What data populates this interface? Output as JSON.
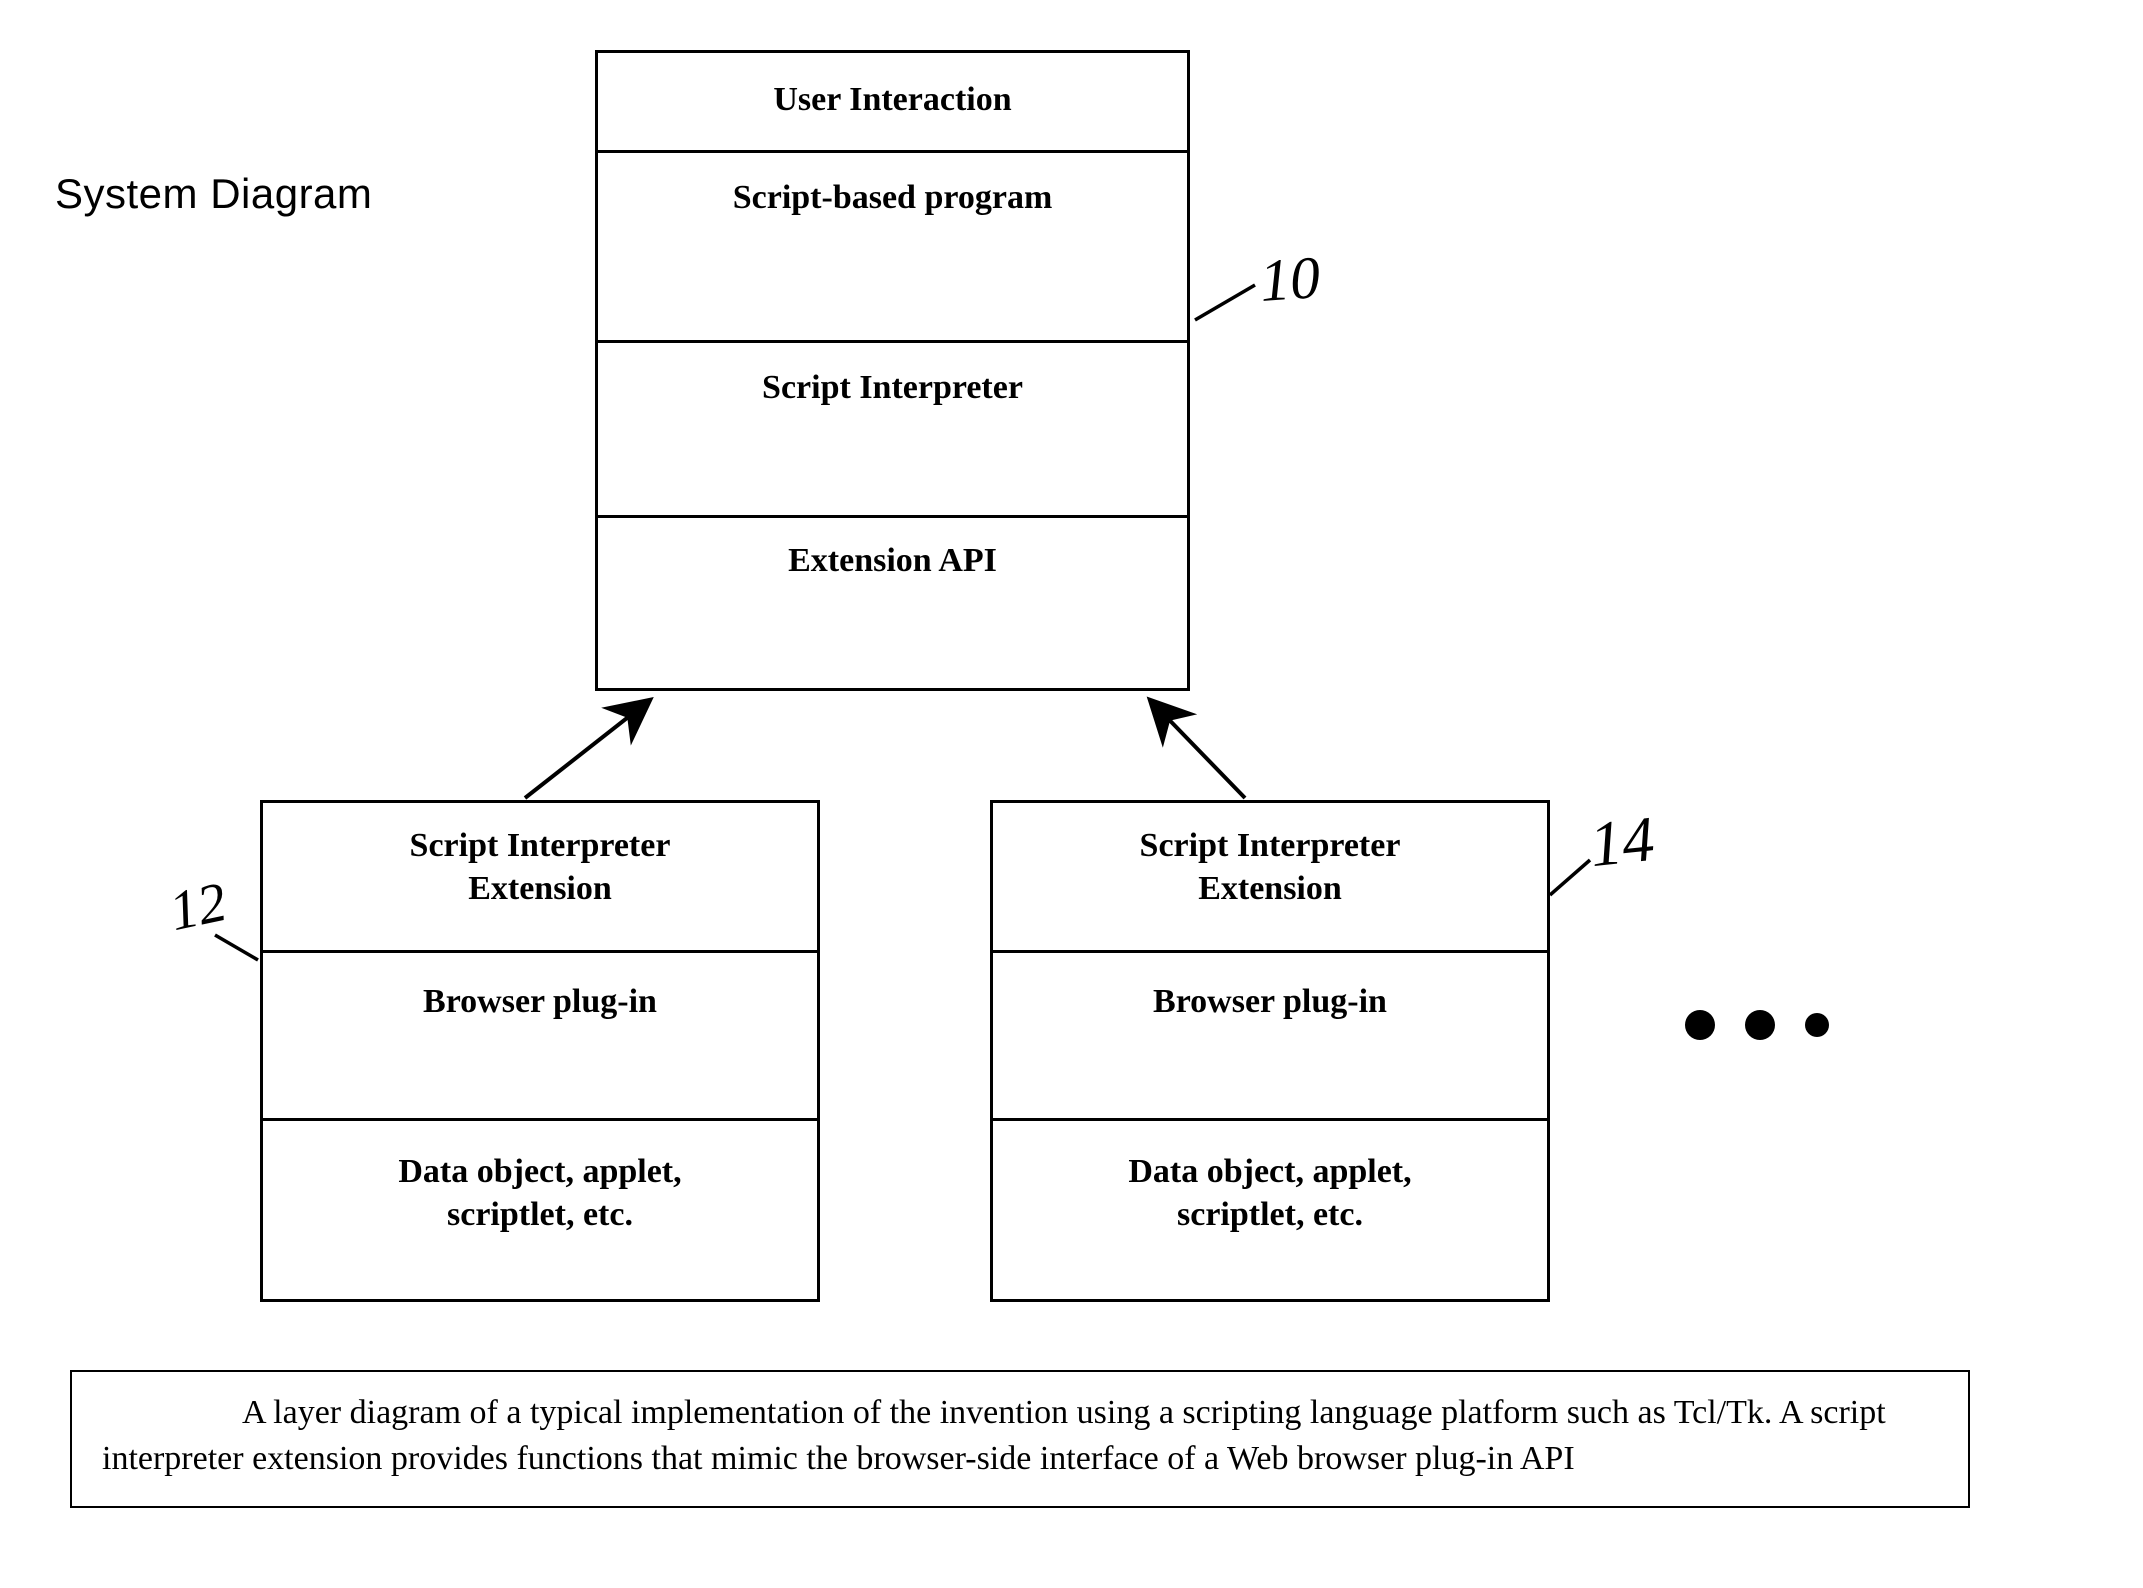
{
  "title": "System Diagram",
  "main_stack": {
    "layer1": "User Interaction",
    "layer2": "Script-based program",
    "layer3": "Script Interpreter",
    "layer4": "Extension API"
  },
  "left_stack": {
    "layer1": "Script Interpreter\nExtension",
    "layer2": "Browser plug-in",
    "layer3": "Data object, applet,\nscriptlet, etc."
  },
  "right_stack": {
    "layer1": "Script Interpreter\nExtension",
    "layer2": "Browser plug-in",
    "layer3": "Data object, applet,\nscriptlet, etc."
  },
  "reference_numbers": {
    "main": "10",
    "left": "12",
    "right": "14"
  },
  "ellipsis": "…",
  "caption": "A layer diagram of a typical implementation of the invention using a scripting language platform such as Tcl/Tk.  A script interpreter extension provides functions that mimic the browser-side interface of a Web browser plug-in API"
}
